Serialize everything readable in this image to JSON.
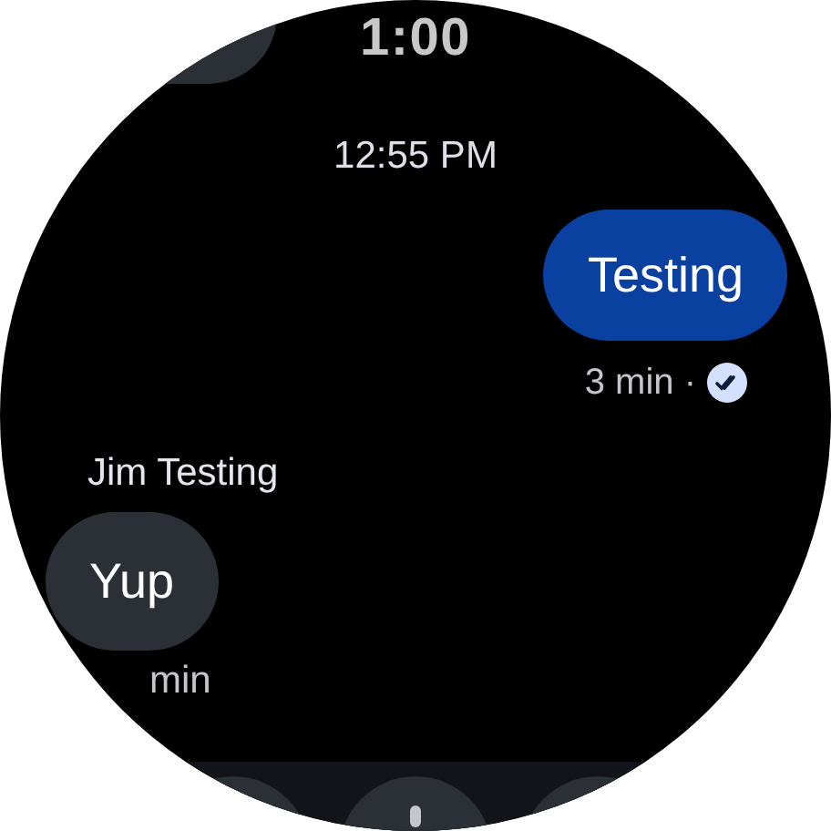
{
  "clock": "1:00",
  "date_header": "12:55 PM",
  "messages": [
    {
      "kind": "sent",
      "text": "Testing",
      "time": "3 min ·",
      "read": true
    },
    {
      "kind": "received",
      "sender": "Jim Testing",
      "text": "Yup",
      "time": "min"
    }
  ]
}
